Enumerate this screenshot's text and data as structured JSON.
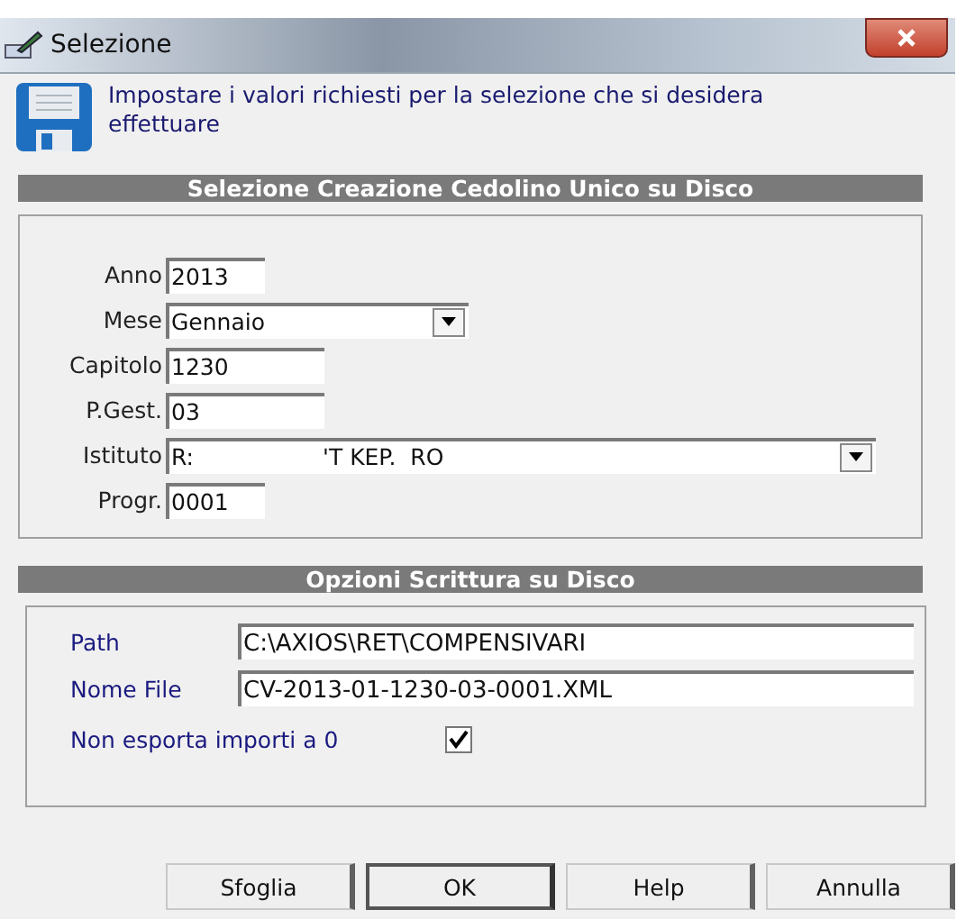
{
  "window": {
    "title": "Selezione"
  },
  "header": {
    "text": "Impostare i valori richiesti per la selezione che si desidera effettuare"
  },
  "sections": [
    {
      "title": "Selezione Creazione Cedolino Unico su Disco",
      "fields": [
        {
          "kind": "text",
          "label": "Anno",
          "value": "2013"
        },
        {
          "kind": "combo",
          "label": "Mese",
          "value": "Gennaio"
        },
        {
          "kind": "text",
          "label": "Capitolo",
          "value": "1230"
        },
        {
          "kind": "text",
          "label": "P.Gest.",
          "value": "03"
        },
        {
          "kind": "combo",
          "label": "Istituto",
          "value": "R:                  'T KEP.  RO"
        },
        {
          "kind": "text",
          "label": "Progr.",
          "value": "0001"
        }
      ]
    },
    {
      "title": "Opzioni Scrittura su Disco",
      "fields": [
        {
          "kind": "wide",
          "label": "Path",
          "value": "C:\\AXIOS\\RET\\COMPENSIVARI"
        },
        {
          "kind": "wide",
          "label": "Nome File",
          "value": "CV-2013-01-1230-03-0001.XML"
        },
        {
          "kind": "check",
          "label": "Non esporta importi a 0",
          "checked": true
        }
      ]
    }
  ],
  "buttons": [
    {
      "label": "Sfoglia",
      "default": false
    },
    {
      "label": "OK",
      "default": true
    },
    {
      "label": "Help",
      "default": false
    },
    {
      "label": "Annulla",
      "default": false
    }
  ]
}
